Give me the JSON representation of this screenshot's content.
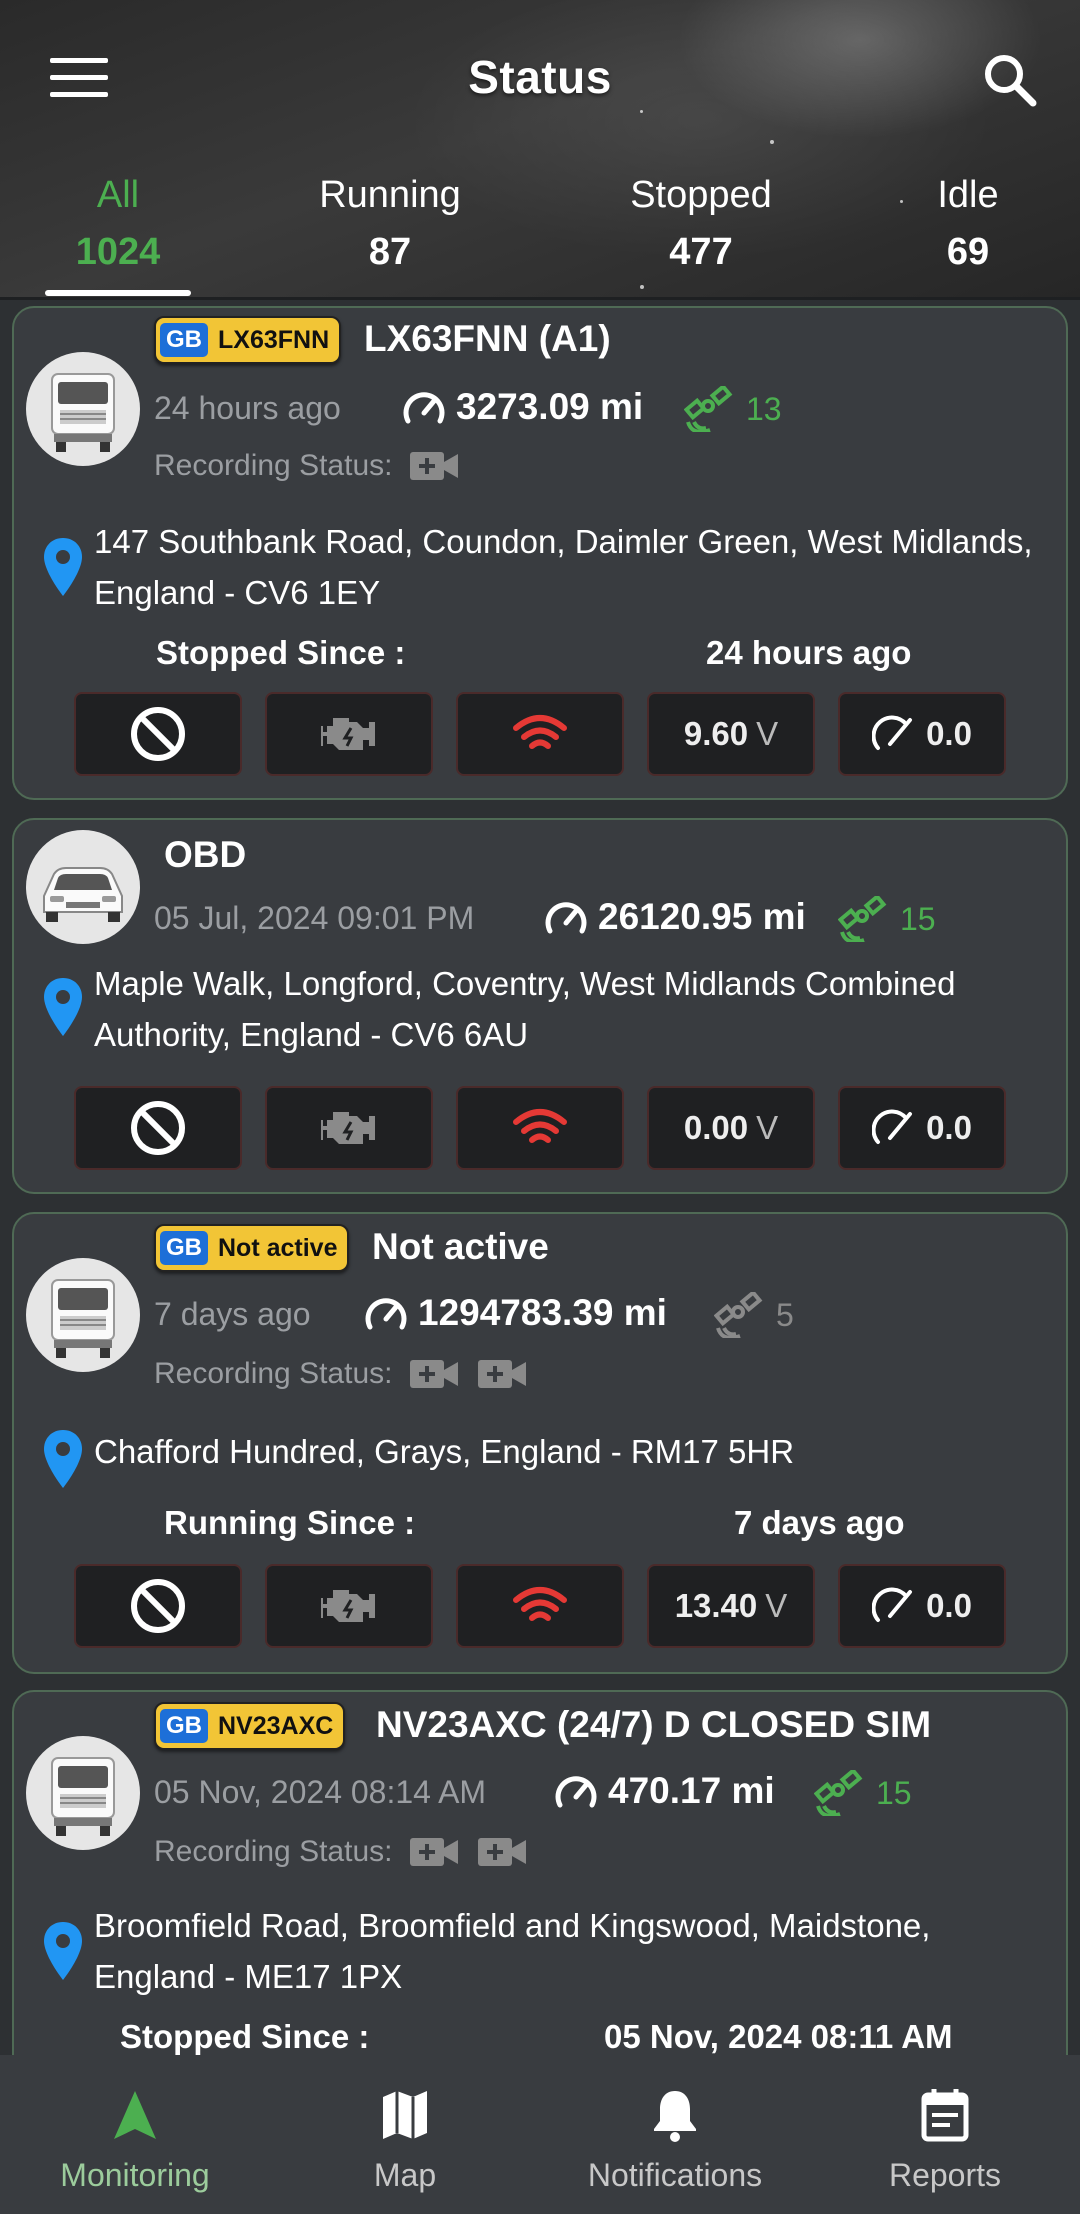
{
  "header": {
    "title": "Status",
    "menu_icon": "hamburger-menu-icon",
    "search_icon": "search-icon"
  },
  "tabs": [
    {
      "label": "All",
      "count": "1024",
      "active": true
    },
    {
      "label": "Running",
      "count": "87",
      "active": false
    },
    {
      "label": "Stopped",
      "count": "477",
      "active": false
    },
    {
      "label": "Idle",
      "count": "69",
      "active": false
    }
  ],
  "vehicles": [
    {
      "avatar": "truck",
      "plate": {
        "country": "GB",
        "number": "LX63FNN"
      },
      "name": "LX63FNN (A1)",
      "time": "24 hours ago",
      "odometer": "3273.09 mi",
      "satellites": "13",
      "recording_label": "Recording Status:",
      "address": "147 Southbank Road, Coundon, Daimler Green, West Midlands, England - CV6 1EY",
      "since_label": "Stopped Since :",
      "since_value": "24 hours ago",
      "voltage": "9.60",
      "voltage_unit": "V",
      "speed": "0.0"
    },
    {
      "avatar": "car",
      "name": "OBD",
      "time": "05 Jul, 2024 09:01 PM",
      "odometer": "26120.95 mi",
      "satellites": "15",
      "address": "Maple Walk, Longford, Coventry, West Midlands Combined Authority, England - CV6 6AU",
      "voltage": "0.00",
      "voltage_unit": "V",
      "speed": "0.0"
    },
    {
      "avatar": "truck",
      "plate": {
        "country": "GB",
        "number": "Not active"
      },
      "name": "Not active",
      "time": "7 days ago",
      "odometer": "1294783.39 mi",
      "satellites": "5",
      "recording_label": "Recording Status:",
      "address": "Chafford Hundred, Grays, England - RM17 5HR",
      "since_label": "Running Since :",
      "since_value": "7 days ago",
      "voltage": "13.40",
      "voltage_unit": "V",
      "speed": "0.0"
    },
    {
      "avatar": "truck",
      "plate": {
        "country": "GB",
        "number": "NV23AXC"
      },
      "name": "NV23AXC (24/7) D CLOSED SIM",
      "time": "05 Nov, 2024 08:14 AM",
      "odometer": "470.17 mi",
      "satellites": "15",
      "recording_label": "Recording Status:",
      "address": "Broomfield Road, Broomfield and Kingswood, Maidstone, England - ME17 1PX",
      "since_label": "Stopped Since :",
      "since_value": "05 Nov, 2024 08:11 AM"
    }
  ],
  "bottom_nav": [
    {
      "label": "Monitoring",
      "icon": "navigation-arrow-icon",
      "active": true
    },
    {
      "label": "Map",
      "icon": "map-icon",
      "active": false
    },
    {
      "label": "Notifications",
      "icon": "bell-icon",
      "active": false
    },
    {
      "label": "Reports",
      "icon": "calendar-report-icon",
      "active": false
    }
  ],
  "colors": {
    "accent_green": "#4caf50",
    "alert_red": "#e53935",
    "plate_yellow": "#f2c536",
    "pin_blue": "#2196f3",
    "card_bg": "#393c40"
  }
}
